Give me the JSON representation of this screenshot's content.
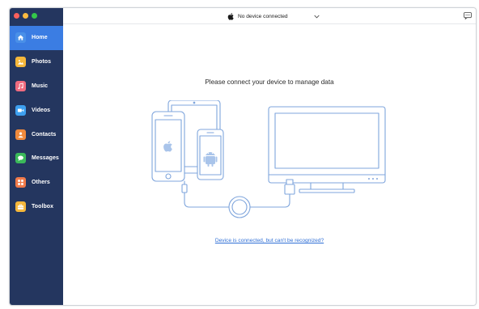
{
  "window": {
    "traffic_lights": [
      {
        "name": "close",
        "color": "#fc605c"
      },
      {
        "name": "minimize",
        "color": "#fcbb40"
      },
      {
        "name": "zoom",
        "color": "#34c84a"
      }
    ]
  },
  "sidebar": {
    "background": "#24365f",
    "active_color": "#3b7de3",
    "items": [
      {
        "label": "Home",
        "icon": "home-icon",
        "color": "#4a90e8",
        "active": true
      },
      {
        "label": "Photos",
        "icon": "photos-icon",
        "color": "#f5b73b",
        "active": false
      },
      {
        "label": "Music",
        "icon": "music-icon",
        "color": "#ef6b7f",
        "active": false
      },
      {
        "label": "Videos",
        "icon": "videos-icon",
        "color": "#3ea0f0",
        "active": false
      },
      {
        "label": "Contacts",
        "icon": "contacts-icon",
        "color": "#f08a3c",
        "active": false
      },
      {
        "label": "Messages",
        "icon": "messages-icon",
        "color": "#3bb95a",
        "active": false
      },
      {
        "label": "Others",
        "icon": "others-icon",
        "color": "#f07a4a",
        "active": false
      },
      {
        "label": "Toolbox",
        "icon": "toolbox-icon",
        "color": "#f5b73b",
        "active": false
      }
    ]
  },
  "topbar": {
    "device_status": "No device connected",
    "device_icon": "apple-icon",
    "dropdown_icon": "chevron-down-icon",
    "feedback_icon": "feedback-icon"
  },
  "main": {
    "prompt": "Please connect your device to manage data",
    "help_link": "Device is connected, but can't be recognized?"
  }
}
